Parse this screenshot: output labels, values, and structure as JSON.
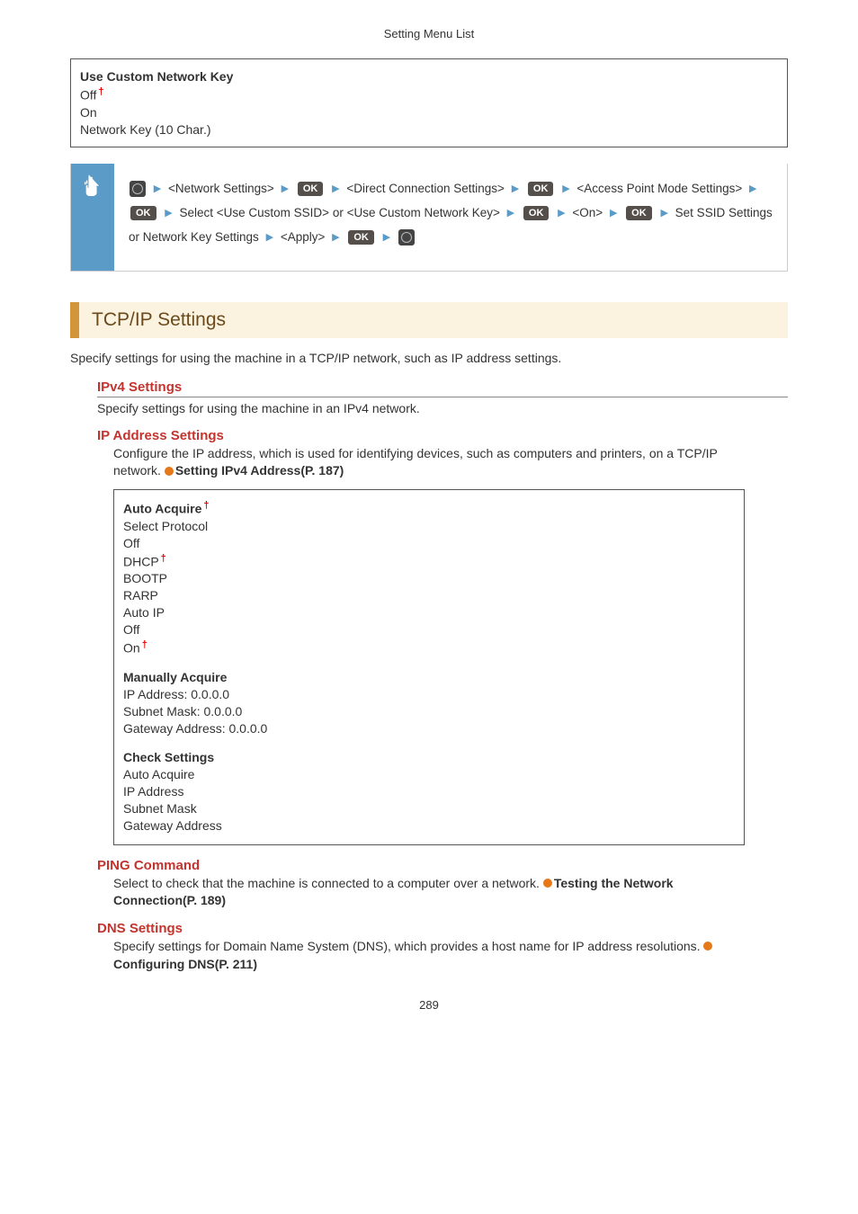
{
  "header": {
    "title": "Setting Menu List"
  },
  "box1": {
    "title": "Use Custom Network Key",
    "off": "Off",
    "on": "On",
    "netkey": "Network Key (10 Char.)"
  },
  "steps": {
    "s1": "<Network Settings>",
    "s2": "<Direct Connection Settings>",
    "s3": "<Access Point Mode Settings>",
    "s4": "Select <Use Custom SSID> or <Use Custom Network Key>",
    "s5": "<On>",
    "s6": "Set SSID Settings or Network Key Settings",
    "s7": "<Apply>",
    "ok": "OK"
  },
  "section": {
    "title": "TCP/IP Settings",
    "desc": "Specify settings for using the machine in a TCP/IP network, such as IP address settings."
  },
  "ipv4": {
    "title": "IPv4 Settings",
    "desc": "Specify settings for using the machine in an IPv4 network."
  },
  "ipaddr": {
    "title": "IP Address Settings",
    "desc": "Configure the IP address, which is used for identifying devices, such as computers and printers, on a TCP/IP network. ",
    "link": "Setting IPv4 Address(P. 187)"
  },
  "ipbox": {
    "autoTitle": "Auto Acquire",
    "selProto": "Select Protocol",
    "off": "Off",
    "dhcp": "DHCP",
    "bootp": "BOOTP",
    "rarp": "RARP",
    "autoip": "Auto IP",
    "off2": "Off",
    "on": "On",
    "manTitle": "Manually Acquire",
    "man1": "IP Address: 0.0.0.0",
    "man2": "Subnet Mask: 0.0.0.0",
    "man3": "Gateway Address: 0.0.0.0",
    "chkTitle": "Check Settings",
    "chk1": "Auto Acquire",
    "chk2": "IP Address",
    "chk3": "Subnet Mask",
    "chk4": "Gateway Address"
  },
  "ping": {
    "title": "PING Command",
    "desc": "Select to check that the machine is connected to a computer over a network. ",
    "link": "Testing the Network Connection(P. 189)"
  },
  "dns": {
    "title": "DNS Settings",
    "desc": "Specify settings for Domain Name System (DNS), which provides a host name for IP address resolutions. ",
    "link": "Configuring DNS(P. 211)"
  },
  "pageNum": "289"
}
